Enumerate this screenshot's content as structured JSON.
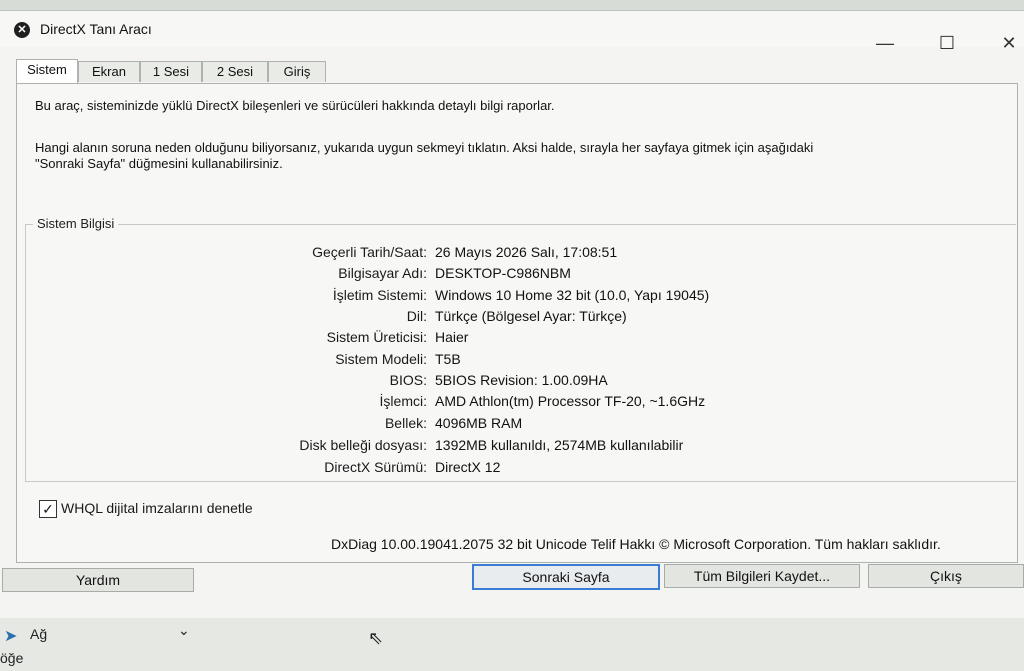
{
  "window": {
    "title": "DirectX Tanı Aracı",
    "minimize": "—",
    "maximize": "☐",
    "close": "✕"
  },
  "tabs": [
    "Sistem",
    "Ekran",
    "1 Sesi",
    "2 Sesi",
    "Giriş"
  ],
  "intro": {
    "line1": "Bu araç, sisteminizde yüklü DirectX bileşenleri ve sürücüleri hakkında detaylı bilgi raporlar.",
    "line2": "Hangi alanın soruna neden olduğunu biliyorsanız, yukarıda uygun sekmeyi tıklatın. Aksi halde, sırayla her sayfaya gitmek için aşağıdaki",
    "line3": "\"Sonraki Sayfa\" düğmesini kullanabilirsiniz."
  },
  "system_info": {
    "group_label": "Sistem Bilgisi",
    "rows": [
      {
        "label": "Geçerli Tarih/Saat:",
        "value": "26 Mayıs 2026 Salı, 17:08:51"
      },
      {
        "label": "Bilgisayar Adı:",
        "value": "DESKTOP-C986NBM"
      },
      {
        "label": "İşletim Sistemi:",
        "value": "Windows 10 Home 32 bit (10.0, Yapı 19045)"
      },
      {
        "label": "Dil:",
        "value": "Türkçe (Bölgesel Ayar: Türkçe)"
      },
      {
        "label": "Sistem Üreticisi:",
        "value": "Haier"
      },
      {
        "label": "Sistem Modeli:",
        "value": "T5B"
      },
      {
        "label": "BIOS:",
        "value": "5BIOS Revision: 1.00.09HA"
      },
      {
        "label": "İşlemci:",
        "value": "AMD Athlon(tm) Processor TF-20, ~1.6GHz"
      },
      {
        "label": "Bellek:",
        "value": "4096MB RAM"
      },
      {
        "label": "Disk belleği dosyası:",
        "value": "1392MB kullanıldı, 2574MB kullanılabilir"
      },
      {
        "label": "DirectX Sürümü:",
        "value": "DirectX 12"
      }
    ]
  },
  "whql": {
    "checked": true,
    "mark": "✓",
    "label": "WHQL dijital imzalarını denetle"
  },
  "version_line": "DxDiag 10.00.19041.2075 32 bit Unicode  Telif Hakkı © Microsoft Corporation. Tüm hakları saklıdır.",
  "buttons": {
    "help": "Yardım",
    "next": "Sonraki Sayfa",
    "save_all": "Tüm Bilgileri Kaydet...",
    "exit": "Çıkış"
  },
  "taskbar": {
    "network_label": "Ağ",
    "chevron": "⌄",
    "partial_text": "öğe"
  }
}
